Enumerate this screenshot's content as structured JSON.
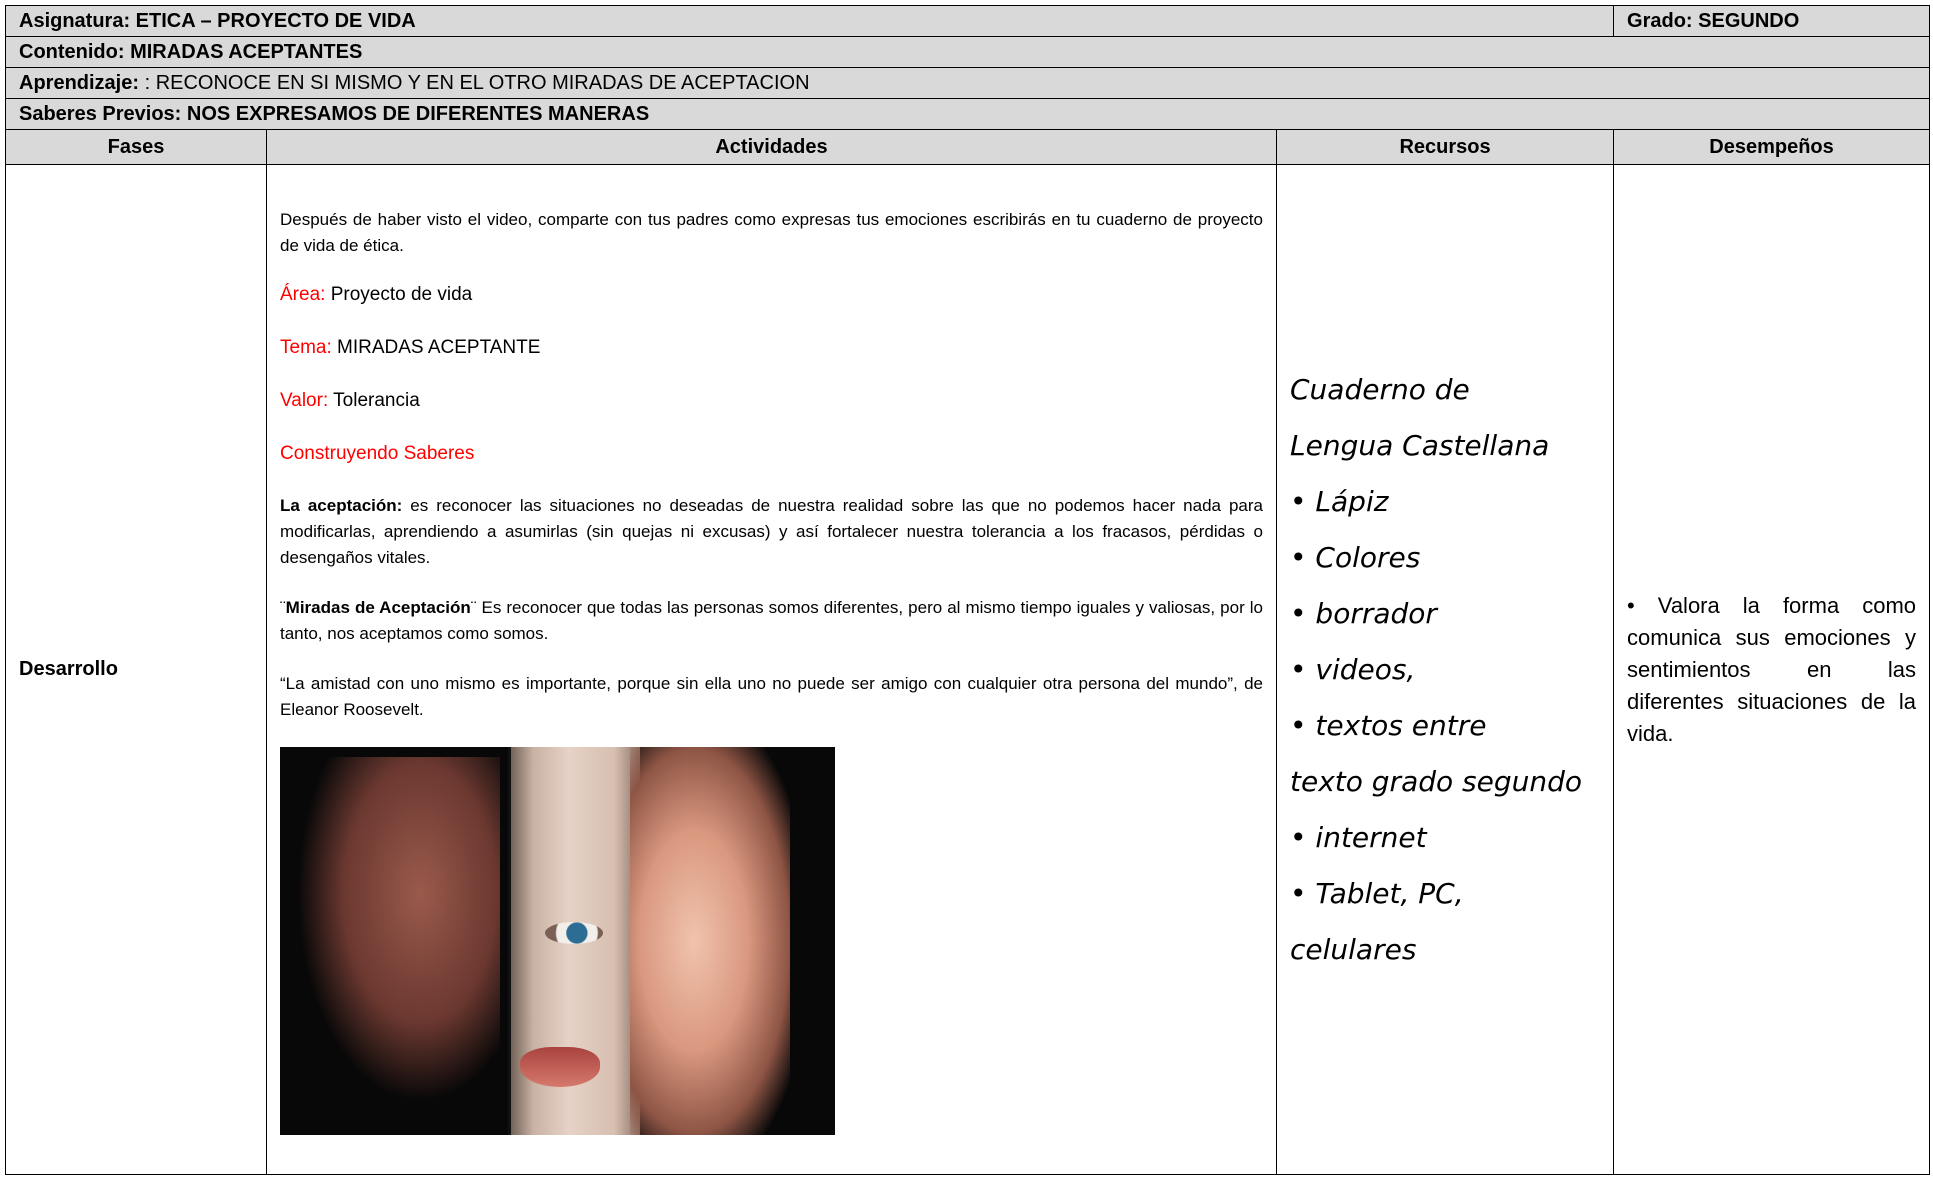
{
  "header": {
    "asignatura_label": "Asignatura: ETICA – PROYECTO DE VIDA",
    "grado_label": "Grado: SEGUNDO",
    "contenido_label": "Contenido: MIRADAS ACEPTANTES",
    "aprendizaje_label": "Aprendizaje:",
    "aprendizaje_value": " :  RECONOCE  EN SI MISMO Y EN  EL OTRO MIRADAS DE ACEPTACION",
    "saberes_label": "Saberes Previos: NOS EXPRESAMOS DE DIFERENTES MANERAS"
  },
  "columns": [
    "Fases",
    "Actividades",
    "Recursos",
    "Desempeños"
  ],
  "row": {
    "fase": "Desarrollo",
    "actividades": {
      "intro": "Después de haber visto el video, comparte con tus padres como expresas tus emociones escribirás en tu cuaderno de proyecto de vida de ética.",
      "area_label": "Área:",
      "area_value": " Proyecto de vida",
      "tema_label": "Tema:",
      "tema_value": " MIRADAS ACEPTANTE",
      "valor_label": "Valor:",
      "valor_value": " Tolerancia",
      "construyendo": "Construyendo Saberes",
      "aceptacion_term": "La aceptación:",
      "aceptacion_text": " es reconocer las situaciones no deseadas de nuestra realidad sobre las que no podemos hacer nada para modificarlas, aprendiendo a asumirlas (sin quejas ni excusas) y así fortalecer nuestra tolerancia a los fracasos, pérdidas o desengaños vitales.",
      "miradas_open": "¨",
      "miradas_term": "Miradas de Aceptación",
      "miradas_text": "¨ Es reconocer que todas las personas somos diferentes, pero al mismo tiempo iguales y valiosas, por lo tanto, nos aceptamos como somos.",
      "quote": "“La amistad con uno mismo es importante, porque sin ella uno no puede ser amigo con cualquier otra persona del mundo”, de Eleanor Roosevelt."
    },
    "recursos": [
      "Cuaderno de",
      "Lengua Castellana",
      "• Lápiz",
      "• Colores",
      "• borrador",
      "• videos,",
      "• textos entre",
      "texto grado segundo",
      "• internet",
      "• Tablet, PC,",
      "celulares"
    ],
    "desempeno": "•          Valora la forma como comunica sus emociones y sentimientos en las diferentes situaciones de la vida."
  },
  "colors": {
    "header_bg": "#d9d9d9",
    "accent_red": "#ff0000"
  }
}
